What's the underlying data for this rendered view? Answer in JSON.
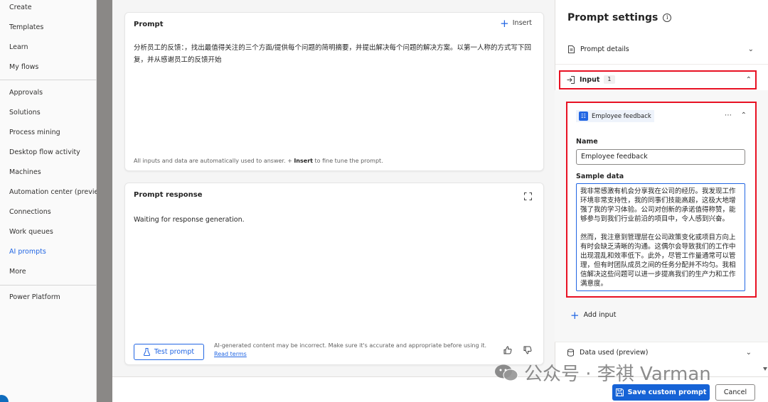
{
  "nav": {
    "items": [
      "Create",
      "Templates",
      "Learn",
      "My flows",
      "Approvals",
      "Solutions",
      "Process mining",
      "Desktop flow activity",
      "Machines",
      "Automation center (previe...",
      "Connections",
      "Work queues",
      "AI prompts",
      "More",
      "Power Platform"
    ],
    "active": "AI prompts"
  },
  "prompt": {
    "title": "Prompt",
    "insert_label": "Insert",
    "text": "分析员工的反馈：，找出最值得关注的三个方面/提供每个问题的简明摘要，并提出解决每个问题的解决方案。以第一人称的方式写下回复，并从感谢员工的反馈开始",
    "footnote_pre": "All inputs and data are automatically used to answer. +",
    "footnote_bold": "Insert",
    "footnote_post": "to fine tune the prompt."
  },
  "response": {
    "title": "Prompt response",
    "text": "Waiting for response generation.",
    "test_button": "Test prompt",
    "disclaimer": "AI-generated content may be incorrect. Make sure it's accurate and appropriate before using it.",
    "read_terms": "Read terms"
  },
  "settings": {
    "title": "Prompt settings",
    "prompt_details": "Prompt details",
    "input_label": "Input",
    "input_count": "1",
    "feedback_name": "Employee feedback",
    "name_label": "Name",
    "name_value": "Employee feedback",
    "sample_label": "Sample data",
    "sample_p1": "我非常感激有机会分享我在公司的经历。我发现工作环境非常支持性，我的同事们技能高超，这极大地增强了我的学习体验。公司对创新的承诺值得称赞，能够参与到我们行业前沿的项目中，令人感到兴奋。",
    "sample_p2": "然而，我注意到管理层在公司政策变化或项目方向上有时会缺乏清晰的沟通。这偶尔会导致我们的工作中出现混乱和效率低下。此外，尽管工作量通常可以管理，但有时团队成员之间的任务分配并不均匀。我相信解决这些问题可以进一步提高我们的生产力和工作满意度。",
    "add_input": "Add input",
    "data_used": "Data used (preview)"
  },
  "footer": {
    "save": "Save custom prompt",
    "cancel": "Cancel"
  },
  "watermark": "公众号 · 李祺 Varman",
  "colors": {
    "accent": "#2266e3",
    "highlight_border": "#e81123",
    "save_bg": "#1663d6"
  }
}
